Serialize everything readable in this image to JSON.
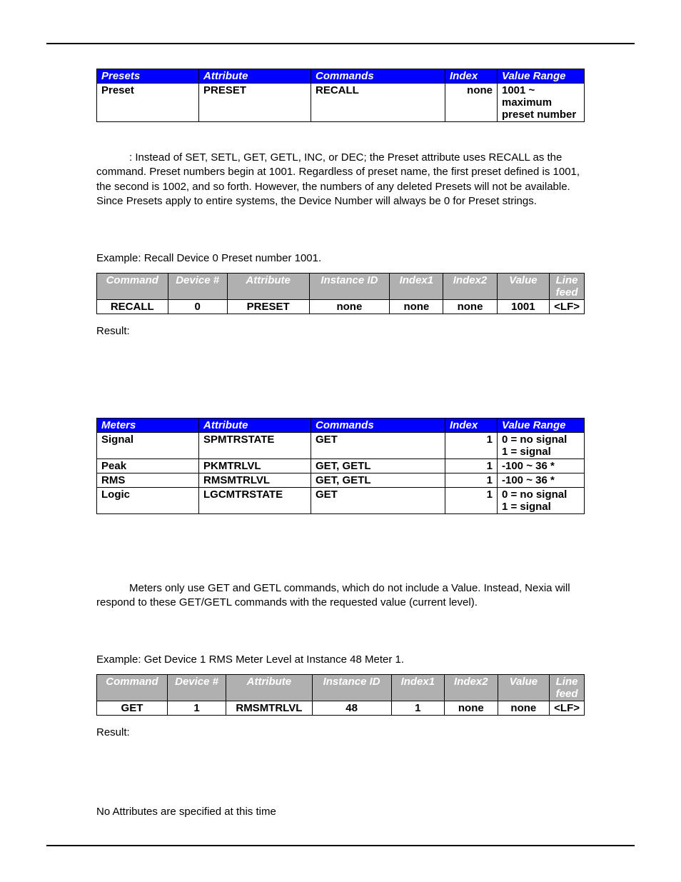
{
  "presets_table": {
    "headers": [
      "Presets",
      "Attribute",
      "Commands",
      "Index",
      "Value Range"
    ],
    "rows": [
      [
        "Preset",
        "PRESET",
        "RECALL",
        "none",
        "1001 ~ maximum preset number"
      ]
    ]
  },
  "presets_note": ": Instead of SET, SETL, GET, GETL, INC, or DEC; the Preset attribute uses RECALL as the command. Preset numbers begin at 1001. Regardless of preset name, the first preset defined is 1001, the second is 1002, and so forth. However, the numbers of any deleted Presets will not be available. Since Presets apply to entire systems, the Device Number will always be 0 for Preset strings.",
  "presets_example_label": "Example: Recall Device 0 Preset number 1001.",
  "cmd_table_headers": [
    "Command",
    "Device #",
    "Attribute",
    "Instance ID",
    "Index1",
    "Index2",
    "Value",
    "Line feed"
  ],
  "presets_cmd_row": [
    "RECALL",
    "0",
    "PRESET",
    "none",
    "none",
    "none",
    "1001",
    "<LF>"
  ],
  "result_label": "Result:",
  "meters_table": {
    "headers": [
      "Meters",
      "Attribute",
      "Commands",
      "Index",
      "Value Range"
    ],
    "rows": [
      [
        "Signal",
        "SPMTRSTATE",
        "GET",
        "1",
        "0 = no signal\n1 = signal"
      ],
      [
        "Peak",
        "PKMTRLVL",
        "GET, GETL",
        "1",
        "-100 ~ 36 *"
      ],
      [
        "RMS",
        "RMSMTRLVL",
        "GET, GETL",
        "1",
        "-100 ~ 36 *"
      ],
      [
        "Logic",
        "LGCMTRSTATE",
        "GET",
        "1",
        "0 = no signal\n1 = signal"
      ]
    ]
  },
  "meters_note": "Meters only use GET and GETL commands, which do not include a Value. Instead, Nexia will respond to these GET/GETL commands with the requested value (current level).",
  "meters_example_label": "Example: Get Device 1 RMS Meter Level at Instance 48 Meter 1.",
  "meters_cmd_row": [
    "GET",
    "1",
    "RMSMTRLVL",
    "48",
    "1",
    "none",
    "none",
    "<LF>"
  ],
  "no_attributes": "No Attributes are specified at this time",
  "chart_data": [
    {
      "type": "table",
      "title": "Presets attribute table",
      "columns": [
        "Presets",
        "Attribute",
        "Commands",
        "Index",
        "Value Range"
      ],
      "rows": [
        [
          "Preset",
          "PRESET",
          "RECALL",
          "none",
          "1001 ~ maximum preset number"
        ]
      ]
    },
    {
      "type": "table",
      "title": "Preset RECALL example",
      "columns": [
        "Command",
        "Device #",
        "Attribute",
        "Instance ID",
        "Index1",
        "Index2",
        "Value",
        "Line feed"
      ],
      "rows": [
        [
          "RECALL",
          "0",
          "PRESET",
          "none",
          "none",
          "none",
          "1001",
          "<LF>"
        ]
      ]
    },
    {
      "type": "table",
      "title": "Meters attribute table",
      "columns": [
        "Meters",
        "Attribute",
        "Commands",
        "Index",
        "Value Range"
      ],
      "rows": [
        [
          "Signal",
          "SPMTRSTATE",
          "GET",
          "1",
          "0 = no signal; 1 = signal"
        ],
        [
          "Peak",
          "PKMTRLVL",
          "GET, GETL",
          "1",
          "-100 ~ 36 *"
        ],
        [
          "RMS",
          "RMSMTRLVL",
          "GET, GETL",
          "1",
          "-100 ~ 36 *"
        ],
        [
          "Logic",
          "LGCMTRSTATE",
          "GET",
          "1",
          "0 = no signal; 1 = signal"
        ]
      ]
    },
    {
      "type": "table",
      "title": "Meter GET example",
      "columns": [
        "Command",
        "Device #",
        "Attribute",
        "Instance ID",
        "Index1",
        "Index2",
        "Value",
        "Line feed"
      ],
      "rows": [
        [
          "GET",
          "1",
          "RMSMTRLVL",
          "48",
          "1",
          "none",
          "none",
          "<LF>"
        ]
      ]
    }
  ]
}
